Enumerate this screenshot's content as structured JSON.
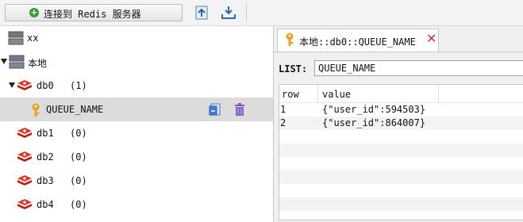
{
  "toolbar": {
    "connect_label": "连接到 Redis 服务器",
    "import_icon": "import-icon",
    "export_icon": "export-icon"
  },
  "tree": {
    "servers": [
      {
        "name": "xx",
        "expanded": false
      },
      {
        "name": "本地",
        "expanded": true
      }
    ],
    "databases": [
      {
        "name": "db0",
        "count": "(1)",
        "expanded": true
      },
      {
        "name": "db1",
        "count": "(0)"
      },
      {
        "name": "db2",
        "count": "(0)"
      },
      {
        "name": "db3",
        "count": "(0)"
      },
      {
        "name": "db4",
        "count": "(0)"
      }
    ],
    "keys": [
      {
        "name": "QUEUE_NAME",
        "selected": true
      }
    ]
  },
  "tab": {
    "label": "本地::db0::QUEUE_NAME",
    "close_icon": "close-icon"
  },
  "editor": {
    "type_label": "LIST:",
    "key_value": "QUEUE_NAME",
    "columns": [
      "row",
      "value"
    ],
    "rows": [
      {
        "row": "1",
        "value": "{\"user_id\":594503}"
      },
      {
        "row": "2",
        "value": "{\"user_id\":864007}"
      }
    ]
  },
  "colors": {
    "accent_green": "#2f9a2f",
    "redis_red": "#c8201c",
    "key_orange": "#f0a020",
    "close_red": "#d62b2b",
    "selected_row": "#dcdcdc"
  }
}
